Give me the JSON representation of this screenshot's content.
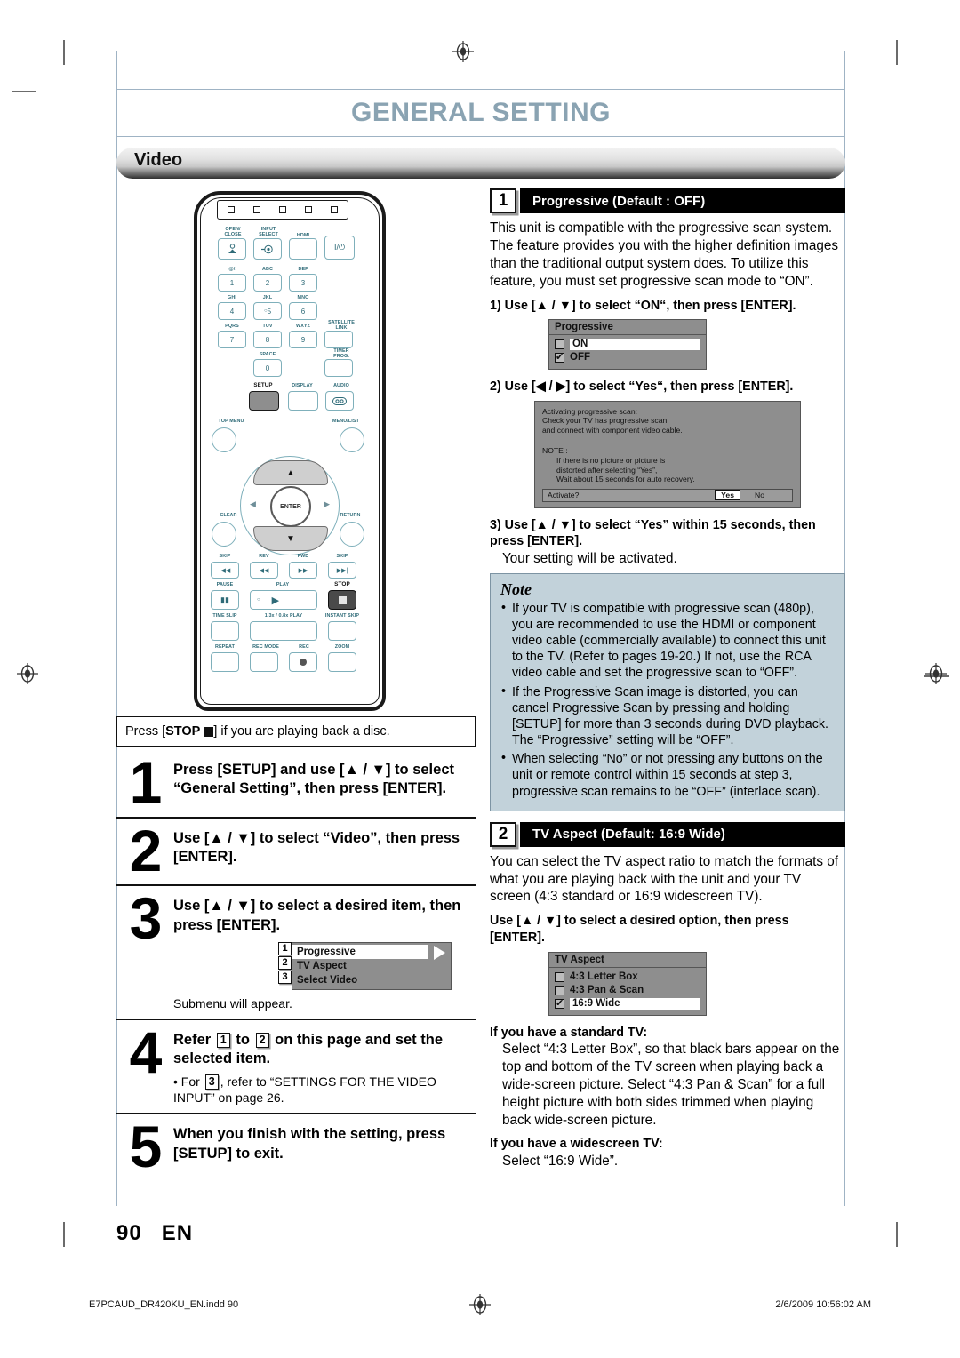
{
  "header": {
    "chapter_title": "GENERAL SETTING",
    "section_title": "Video"
  },
  "remote": {
    "top_buttons_count": 5,
    "labels": {
      "open_close": "OPEN/\nCLOSE",
      "input_select": "INPUT\nSELECT",
      "hdmi": "HDMI",
      "power": "I/⏻",
      "k1_top": ".@/:",
      "k2_top": "ABC",
      "k3_top": "DEF",
      "k4_top": "GHI",
      "k5_top": "JKL",
      "k6_top": "MNO",
      "k7_top": "PQRS",
      "k8_top": "TUV",
      "k9_top": "WXYZ",
      "satellite_link": "SATELLITE\nLINK",
      "space": "SPACE",
      "timer_prog": "TIMER\nPROG.",
      "setup": "SETUP",
      "display": "DISPLAY",
      "audio": "AUDIO",
      "top_menu": "TOP MENU",
      "menu_list": "MENU/LIST",
      "clear": "CLEAR",
      "return": "RETURN",
      "skip_back": "SKIP",
      "rev": "REV",
      "fwd": "FWD",
      "skip_fwd": "SKIP",
      "pause": "PAUSE",
      "play": "PLAY",
      "stop": "STOP",
      "time_slip": "TIME SLIP",
      "speed_play": "1.3x / 0.8x PLAY",
      "instant_skip": "INSTANT SKIP",
      "repeat": "REPEAT",
      "rec_mode": "REC MODE",
      "rec": "REC",
      "zoom": "ZOOM"
    },
    "keys": {
      "k1": "1",
      "k2": "2",
      "k3": "3",
      "k4": "4",
      "k5": "5",
      "k6": "6",
      "k7": "7",
      "k8": "8",
      "k9": "9",
      "k0": "0"
    },
    "dpad": {
      "enter": "ENTER",
      "up": "▲",
      "down": "▼",
      "left": "◀",
      "right": "▶"
    }
  },
  "left": {
    "caption_prefix": "Press [",
    "caption_stop": "STOP",
    "caption_suffix": "] if you are playing back a disc.",
    "steps": [
      {
        "num": "1",
        "text": "Press [SETUP] and use [▲ / ▼] to select “General Setting”, then press [ENTER]."
      },
      {
        "num": "2",
        "text": "Use [▲ / ▼] to select “Video”, then press [ENTER]."
      },
      {
        "num": "3",
        "text": "Use [▲ / ▼] to select a desired item, then press [ENTER].",
        "submenu": {
          "rows": [
            {
              "n": "1",
              "label": "Progressive",
              "selected": true
            },
            {
              "n": "2",
              "label": "TV Aspect",
              "selected": false
            },
            {
              "n": "3",
              "label": "Select Video",
              "selected": false
            }
          ]
        },
        "after": "Submenu will appear."
      },
      {
        "num": "4",
        "text_a": "Refer",
        "ref_a": "1",
        "text_b": "to",
        "ref_b": "2",
        "text_c": "on this page and set the selected item.",
        "bullet_a": "• For",
        "bullet_ref": "3",
        "bullet_b": ", refer to “SETTINGS FOR THE VIDEO INPUT” on page 26."
      },
      {
        "num": "5",
        "text": "When you finish with the setting, press [SETUP] to exit."
      }
    ]
  },
  "right": {
    "block1": {
      "badge": "1",
      "bar_title": "Progressive (Default : OFF)",
      "paragraph": "This unit is compatible with the progressive scan system. The feature provides you with the higher definition images than the traditional output system does. To utilize this feature, you must set progressive scan mode to “ON”.",
      "step1": "1) Use [▲ / ▼] to select “ON“, then press [ENTER].",
      "osd": {
        "title": "Progressive",
        "items": [
          {
            "label": "ON",
            "checked": false,
            "highlight": true
          },
          {
            "label": "OFF",
            "checked": true,
            "highlight": false
          }
        ]
      },
      "step2": "2) Use [◀ / ▶] to select “Yes“, then press [ENTER].",
      "dialog": {
        "line1": "Activating progressive scan:",
        "line2": "Check your TV has progressive scan",
        "line3": "and connect with component video cable.",
        "note_label": "NOTE :",
        "note1": "If there is no picture or picture is",
        "note2": "distorted after selecting “Yes”,",
        "note3": "Wait about 15 seconds for auto recovery.",
        "prompt": "Activate?",
        "yes": "Yes",
        "no": "No"
      },
      "step3": "3) Use [▲ / ▼] to select “Yes” within 15 seconds, then press [ENTER].",
      "step3_sub": "Your setting will be activated."
    },
    "note": {
      "title": "Note",
      "items": [
        "If your TV is compatible with progressive scan (480p), you are recommended to use the HDMI or component video cable (commercially available) to connect this unit to the TV. (Refer to pages 19-20.) If not, use the RCA video cable and set the progressive scan to “OFF”.",
        "If the Progressive Scan image is distorted, you can cancel Progressive Scan by pressing and holding [SETUP] for more than 3 seconds during DVD playback. The “Progressive” setting will be “OFF”.",
        "When selecting “No” or not pressing any buttons on the unit or remote control within 15 seconds at step 3, progressive scan remains to be “OFF” (interlace scan)."
      ]
    },
    "block2": {
      "badge": "2",
      "bar_title": "TV Aspect (Default: 16:9 Wide)",
      "paragraph": "You can select the TV aspect ratio to match the formats of what you are playing back with the unit and your TV screen (4:3 standard or 16:9 widescreen TV).",
      "step": "Use [▲ / ▼] to select a desired option, then press [ENTER].",
      "osd": {
        "title": "TV Aspect",
        "items": [
          {
            "label": "4:3 Letter Box",
            "checked": false,
            "highlight": false
          },
          {
            "label": "4:3 Pan & Scan",
            "checked": false,
            "highlight": false
          },
          {
            "label": "16:9 Wide",
            "checked": true,
            "highlight": true
          }
        ]
      },
      "std_head": "If you have a standard TV:",
      "std_body": "Select “4:3 Letter Box”, so that black bars appear on the top and bottom of the TV screen when playing back a wide-screen picture. Select “4:3 Pan & Scan” for a full height picture with both sides trimmed when playing back wide-screen picture.",
      "wide_head": "If you have a widescreen TV:",
      "wide_body": "Select “16:9 Wide”."
    }
  },
  "page": {
    "number": "90",
    "lang": "EN"
  },
  "footer": {
    "file": "E7PCAUD_DR420KU_EN.indd   90",
    "date": "2/6/2009   10:56:02 AM"
  }
}
